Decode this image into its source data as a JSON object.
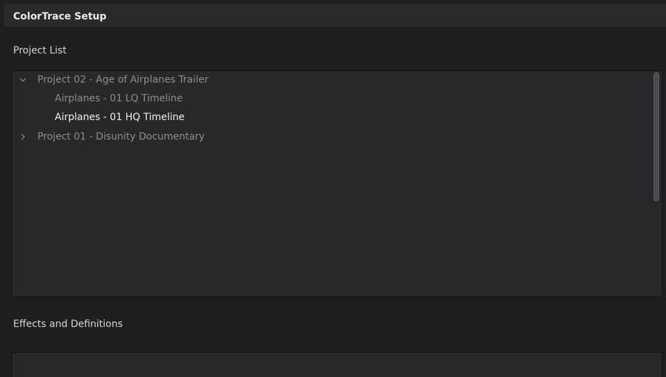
{
  "window": {
    "title": "ColorTrace Setup"
  },
  "project_list": {
    "label": "Project List",
    "projects": [
      {
        "name": "Project 02 - Age of Airplanes Trailer",
        "expanded": true,
        "timelines": [
          {
            "name": "Airplanes - 01 LQ Timeline",
            "selected": false
          },
          {
            "name": "Airplanes - 01 HQ Timeline",
            "selected": true
          }
        ]
      },
      {
        "name": "Project 01 - Disunity Documentary",
        "expanded": false,
        "timelines": []
      }
    ]
  },
  "effects": {
    "label": "Effects and Definitions"
  },
  "colors": {
    "background": "#1f1f22",
    "panel": "#28282b",
    "text_dim": "#8f8f8f",
    "text_selected": "#f2f2f2"
  }
}
